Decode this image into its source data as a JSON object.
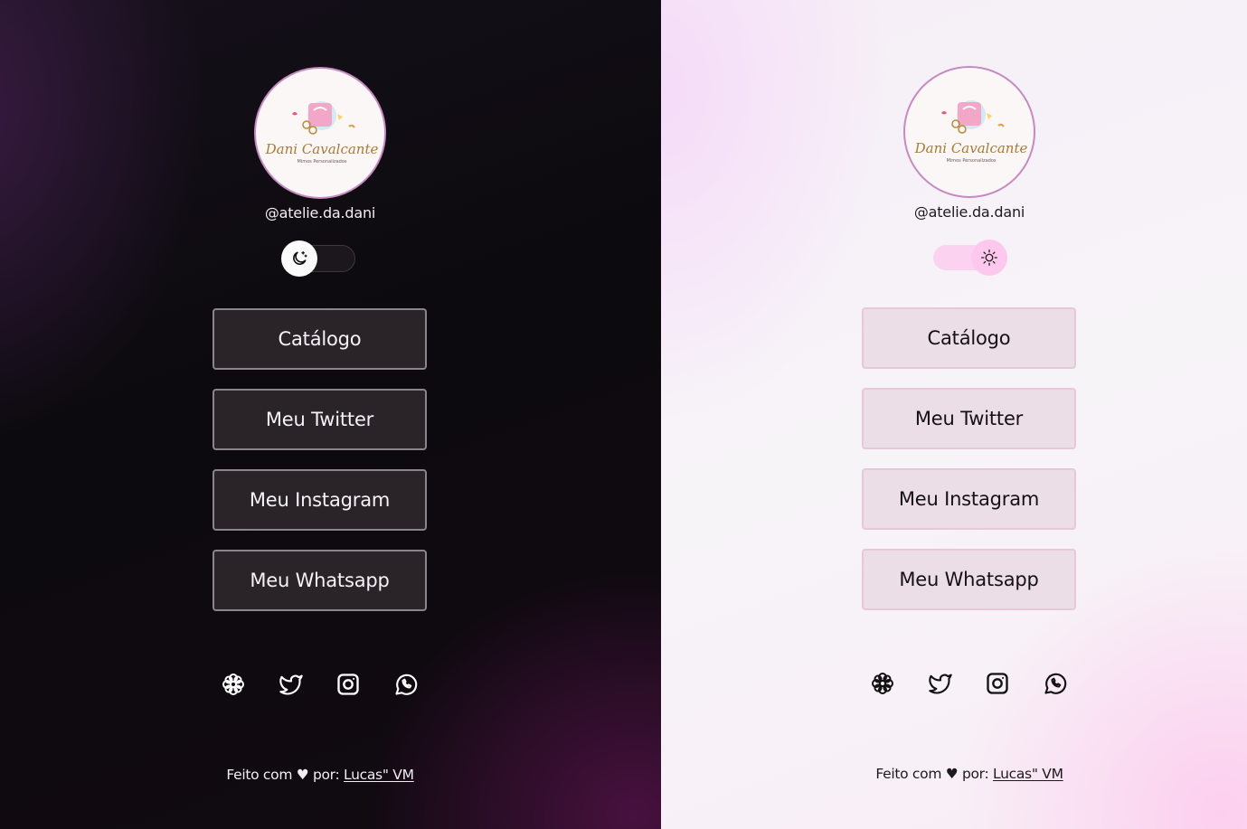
{
  "panels": [
    {
      "theme": "dark",
      "profile": {
        "handle": "@atelie.da.dani",
        "logo_title": "Dani Cavalcante",
        "logo_subtitle": "Mimos Personalizados"
      },
      "theme_toggle": {
        "icon": "moon-icon",
        "state": "dark"
      },
      "links": [
        "Catálogo",
        "Meu Twitter",
        "Meu Instagram",
        "Meu Whatsapp"
      ],
      "socials": [
        "flower-icon",
        "twitter-icon",
        "instagram-icon",
        "whatsapp-icon"
      ],
      "footer": {
        "text": "Feito com ♥ por: ",
        "link": "Lucas\" VM"
      },
      "colors": {
        "background": "#0c0a0e",
        "button_bg": "#2a2429",
        "button_border": "#8b848b",
        "text": "#f6f2f6"
      }
    },
    {
      "theme": "light",
      "profile": {
        "handle": "@atelie.da.dani",
        "logo_title": "Dani Cavalcante",
        "logo_subtitle": "Mimos Personalizados"
      },
      "theme_toggle": {
        "icon": "sun-icon",
        "state": "light"
      },
      "links": [
        "Catálogo",
        "Meu Twitter",
        "Meu Instagram",
        "Meu Whatsapp"
      ],
      "socials": [
        "flower-icon",
        "twitter-icon",
        "instagram-icon",
        "whatsapp-icon"
      ],
      "footer": {
        "text": "Feito com ♥ por: ",
        "link": "Lucas\" VM"
      },
      "colors": {
        "background": "#f7f4f8",
        "button_bg": "#ecdee6",
        "button_border": "#e7c8da",
        "text": "#141114",
        "toggle_accent": "#fdc8ee"
      }
    }
  ]
}
